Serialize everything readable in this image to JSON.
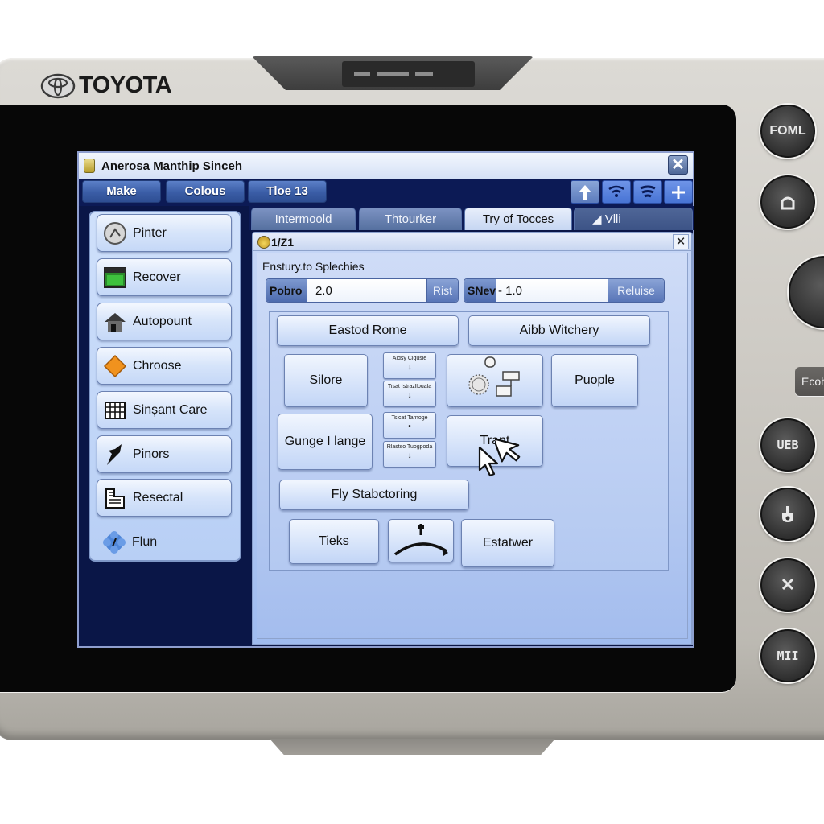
{
  "device": {
    "brand": "TOYOTA",
    "hardware_buttons": [
      {
        "id": "hw-foml",
        "label": "FOML"
      },
      {
        "id": "hw-home",
        "label": "home-icon"
      },
      {
        "id": "hw-dial",
        "label": ""
      },
      {
        "id": "hw-eco",
        "label": "Ecoh"
      },
      {
        "id": "hw-usb",
        "label": "UEB"
      },
      {
        "id": "hw-hand",
        "label": "hand-icon"
      },
      {
        "id": "hw-close",
        "label": "✕"
      },
      {
        "id": "hw-mii",
        "label": "MII"
      }
    ]
  },
  "window": {
    "title": "Anerosa Manthip Sinceh",
    "close": "✕"
  },
  "menubar": {
    "buttons": [
      "Make",
      "Colous",
      "Tloe 13"
    ],
    "tools": [
      "upload-icon",
      "wifi-icon",
      "wifi-strong-icon",
      "add-icon"
    ]
  },
  "sidebar": {
    "items": [
      {
        "label": "Pinter",
        "icon": "gauge-icon"
      },
      {
        "label": "Recover",
        "icon": "green-window-icon"
      },
      {
        "label": "Autopount",
        "icon": "house-icon"
      },
      {
        "label": "Chroose",
        "icon": "diamond-icon"
      },
      {
        "label": "Sinșant Care",
        "icon": "grid-icon"
      },
      {
        "label": "Pinors",
        "icon": "bird-icon"
      },
      {
        "label": "Resectal",
        "icon": "building-icon"
      },
      {
        "label": "Flun",
        "icon": "gear-flower-icon"
      }
    ]
  },
  "tabs": [
    {
      "label": "Intermoold",
      "active": false
    },
    {
      "label": "Thtourker",
      "active": false
    },
    {
      "label": "Try of Tocces",
      "active": true
    },
    {
      "label": "◢ Vlli",
      "active": false
    }
  ],
  "subwindow": {
    "title": "1/Z1",
    "close": "✕",
    "heading": "Enstury.to Splechies",
    "field1": {
      "label": "Pobro",
      "value": "2.0",
      "button": "Rist"
    },
    "field2": {
      "label": "SNev.e",
      "value": "- 1.0",
      "button": "Reluise"
    },
    "grid": {
      "wide_buttons": [
        "Eastod Rome",
        "Aibb Witchery"
      ],
      "big_buttons": [
        "Silore",
        "Puople",
        "Gunge I lange",
        "Trant"
      ],
      "mini_buttons": [
        {
          "label": "Aldsy Ciqusle",
          "arrow": "↓"
        },
        {
          "label": "Tisat Istrazllouala",
          "arrow": "↓"
        },
        {
          "label": "Tsicat Tarnoge",
          "arrow": "•"
        },
        {
          "label": "Rlastso Tuogpoda",
          "arrow": "↓"
        }
      ],
      "diagram_button": "diagram-icon",
      "fly_button": "Fly Stabctoring",
      "bottom_buttons": [
        "Tieks",
        "Estatwer"
      ],
      "arc_button": "arc-gauge-icon"
    }
  }
}
